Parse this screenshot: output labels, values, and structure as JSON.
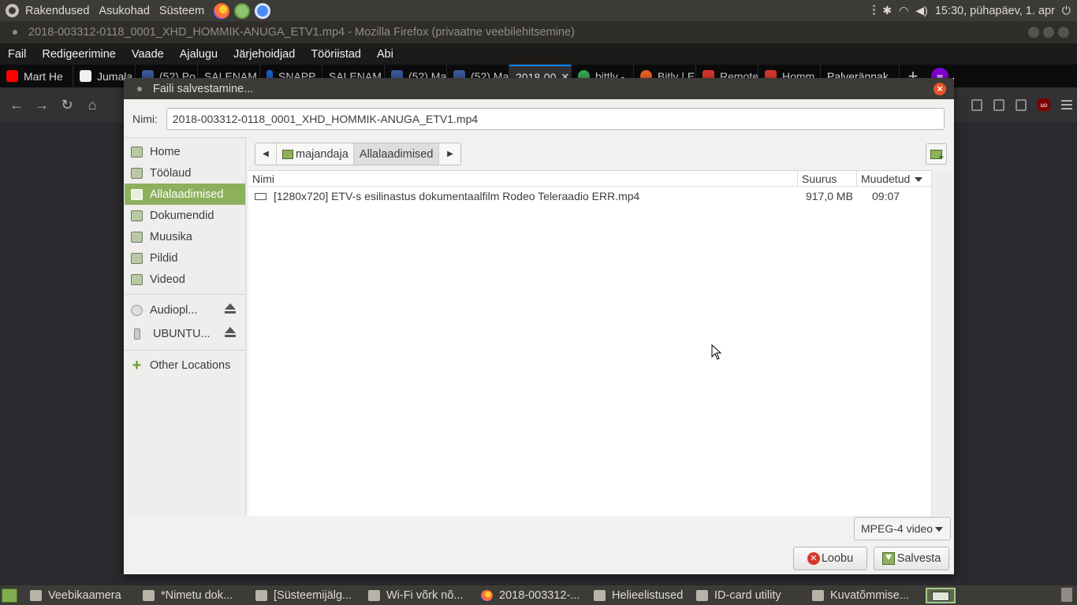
{
  "top_panel": {
    "menus": [
      "Rakendused",
      "Asukohad",
      "Süsteem"
    ],
    "clock": "15:30, pühapäev, 1. apr"
  },
  "browser": {
    "window_title": "2018-003312-0118_0001_XHD_HOMMIK-ANUGA_ETV1.mp4 - Mozilla Firefox (privaatne veebilehitsemine)",
    "menu": [
      "Fail",
      "Redigeerimine",
      "Vaade",
      "Ajalugu",
      "Järjehoidjad",
      "Tööriistad",
      "Abi"
    ],
    "tabs": [
      {
        "label": "Mart He",
        "color": "#ff0000"
      },
      {
        "label": "Jumala",
        "color": "#ffffff"
      },
      {
        "label": "(52) Po",
        "color": "#3b5998"
      },
      {
        "label": "SALENAM",
        "color": "#0c0c0d"
      },
      {
        "label": "SNAPP",
        "color": "#1a5fc7"
      },
      {
        "label": "SALENAM",
        "color": "#0c0c0d"
      },
      {
        "label": "(52) Ma",
        "color": "#3b5998"
      },
      {
        "label": "(52) Ma",
        "color": "#3b5998"
      },
      {
        "label": "2018-00",
        "color": "#323234"
      },
      {
        "label": "bittly -",
        "color": "#34a853"
      },
      {
        "label": "Bitly | E",
        "color": "#ee6123"
      },
      {
        "label": "Remote",
        "color": "#d7372b"
      },
      {
        "label": "Homm",
        "color": "#d7372b"
      },
      {
        "label": "Palverännak",
        "color": "#0c0c0d"
      }
    ]
  },
  "dialog": {
    "title": "Faili salvestamine...",
    "name_label": "Nimi:",
    "filename": "2018-003312-0118_0001_XHD_HOMMIK-ANUGA_ETV1.mp4",
    "sidebar": [
      {
        "label": "Home",
        "icon": "home-folder-icon"
      },
      {
        "label": "Töölaud",
        "icon": "desktop-folder-icon"
      },
      {
        "label": "Allalaadimised",
        "icon": "downloads-folder-icon",
        "active": true
      },
      {
        "label": "Dokumendid",
        "icon": "documents-folder-icon"
      },
      {
        "label": "Muusika",
        "icon": "music-folder-icon"
      },
      {
        "label": "Pildid",
        "icon": "pictures-folder-icon"
      },
      {
        "label": "Videod",
        "icon": "videos-folder-icon"
      }
    ],
    "devices": [
      {
        "label": "Audiopl...",
        "icon": "disc-icon"
      },
      {
        "label": "UBUNTU...",
        "icon": "usb-drive-icon"
      }
    ],
    "other_locations": "Other Locations",
    "path": [
      "majandaja",
      "Allalaadimised"
    ],
    "columns": {
      "name": "Nimi",
      "size": "Suurus",
      "modified": "Muudetud"
    },
    "files": [
      {
        "name": "[1280x720] ETV-s esilinastus dokumentaalfilm Rodeo  Teleraadio  ERR.mp4",
        "size": "917,0 MB",
        "modified": "09:07"
      }
    ],
    "filter": "MPEG-4 video",
    "cancel_label": "Loobu",
    "save_label": "Salvesta"
  },
  "taskbar": [
    {
      "label": "Veebikaamera"
    },
    {
      "label": "*Nimetu dok..."
    },
    {
      "label": "[Süsteemijälg..."
    },
    {
      "label": "Wi-Fi võrk nõ..."
    },
    {
      "label": "2018-003312-..."
    },
    {
      "label": "Helieelistused"
    },
    {
      "label": "ID-card utility"
    },
    {
      "label": "Kuvatõmmise..."
    }
  ]
}
